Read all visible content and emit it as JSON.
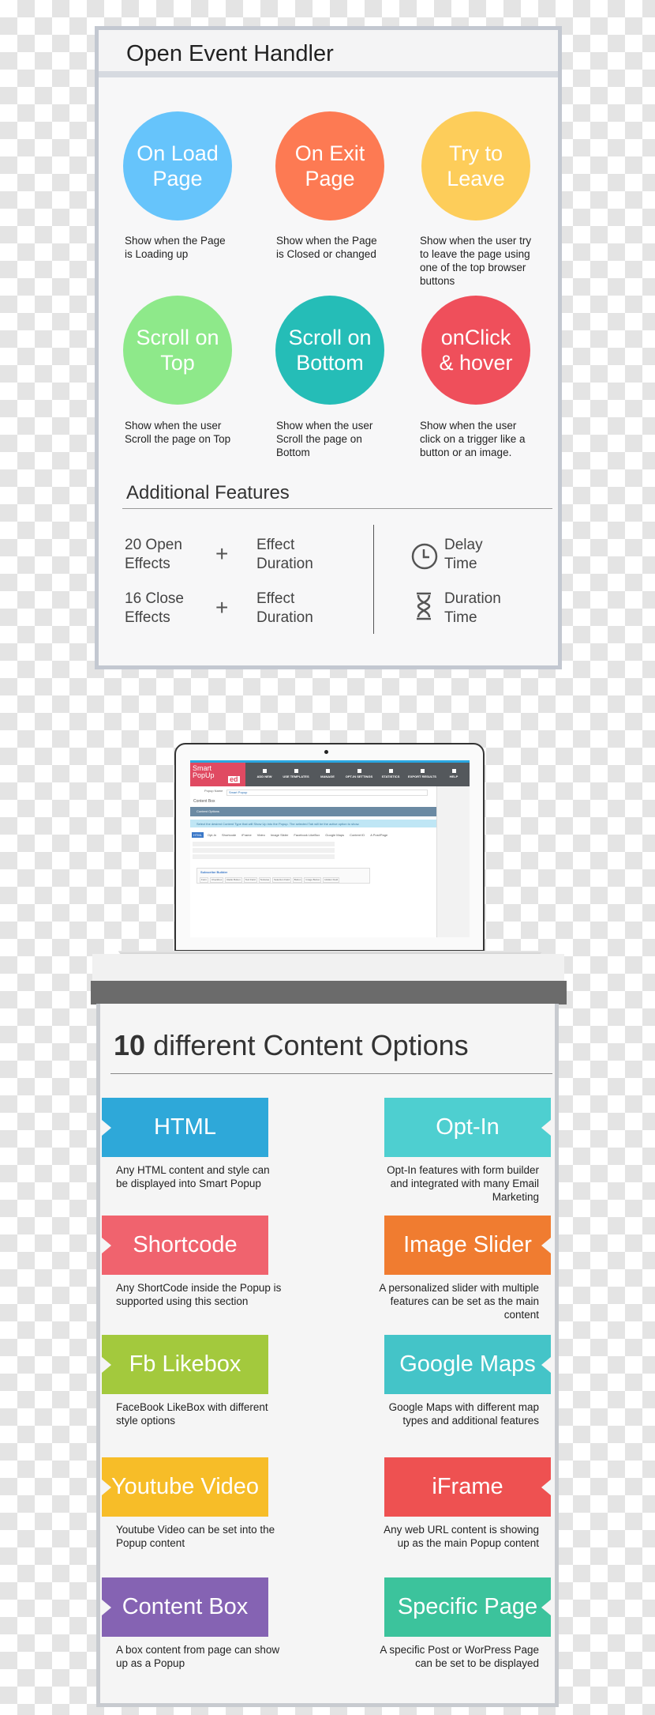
{
  "event_handler": {
    "title": "Open Event Handler",
    "events": [
      {
        "label": "On Load Page",
        "color": "#66c4fb",
        "desc": "Show when the Page is Loading up"
      },
      {
        "label": "On Exit Page",
        "color": "#fd7a53",
        "desc": "Show when the Page is Closed or changed"
      },
      {
        "label": "Try to Leave",
        "color": "#fdcd5a",
        "desc": "Show when the user try to leave the page using one of the top browser buttons"
      },
      {
        "label": "Scroll on Top",
        "color": "#8ee98a",
        "desc": "Show when the user Scroll the page on Top"
      },
      {
        "label": "Scroll on Bottom",
        "color": "#25bdb7",
        "desc": "Show when the user Scroll the page on Bottom"
      },
      {
        "label": "onClick & hover",
        "color": "#ef4f5b",
        "desc": "Show when the user click on a trigger like a button or an image."
      }
    ],
    "additional": {
      "title": "Additional Features",
      "open_effects": "20 Open Effects",
      "close_effects": "16 Close Effects",
      "effect_duration": "Effect Duration",
      "plus": "+",
      "delay_time": "Delay Time",
      "duration_time": "Duration Time",
      "icons": [
        "clock-icon",
        "hourglass-icon"
      ]
    }
  },
  "laptop_screen": {
    "logo": "Smart PopUp",
    "logo_badge": "ed",
    "nav": [
      "ADD NEW",
      "USE TEMPLATES",
      "MANAGE",
      "OPT-IN SETTINGS",
      "STATISTICS",
      "EXPORT RESULTS",
      "HELP"
    ],
    "popup_name_label": "Popup Name",
    "popup_name_value": "Smart Popup",
    "content_box": "Content Box",
    "content_options": "Content Options",
    "info": "Select the desired Content Type that will Show Up into the Popup. The selected Tab will be the active option to show.",
    "tabs": [
      "HTML",
      "Opt-In",
      "Shortcode",
      "iFrame",
      "Video",
      "Image Slider",
      "Facebook LikeBox",
      "Google Maps",
      "Content ID",
      "A Post/Page"
    ],
    "subscribe_builder": "Subscribe Builder",
    "builder_buttons": [
      "Form",
      "Checkbox",
      "Radio Button",
      "Text Field",
      "Textarea",
      "Selection Field",
      "Button",
      "Image Button",
      "Hidden Field"
    ]
  },
  "content_options": {
    "title_number": "10",
    "title_rest": "different Content Options",
    "items": [
      {
        "label": "HTML",
        "color": "#2ea8d9",
        "desc": "Any HTML content and style can be displayed into Smart Popup"
      },
      {
        "label": "Opt-In",
        "color": "#4ecfd0",
        "desc": "Opt-In features with form builder and integrated with many Email Marketing"
      },
      {
        "label": "Shortcode",
        "color": "#f0636e",
        "desc": "Any ShortCode inside the Popup is supported using this section"
      },
      {
        "label": "Image Slider",
        "color": "#f07c30",
        "desc": "A personalized slider with multiple features can be set as the main content"
      },
      {
        "label": "Fb Likebox",
        "color": "#a3c93d",
        "desc": "FaceBook LikeBox with different style options"
      },
      {
        "label": "Google Maps",
        "color": "#44c4c8",
        "desc": "Google Maps with different map types and additional features"
      },
      {
        "label": "Youtube Video",
        "color": "#f7bd28",
        "desc": "Youtube Video can be set into the Popup content"
      },
      {
        "label": "iFrame",
        "color": "#ee5151",
        "desc": "Any web URL content is showing up as the main Popup content"
      },
      {
        "label": "Content Box",
        "color": "#8563b3",
        "desc": "A box content from page can show up as a Popup"
      },
      {
        "label": "Specific Page",
        "color": "#3cc39c",
        "desc": "A specific Post or WorPress Page can be set to be displayed"
      }
    ]
  }
}
